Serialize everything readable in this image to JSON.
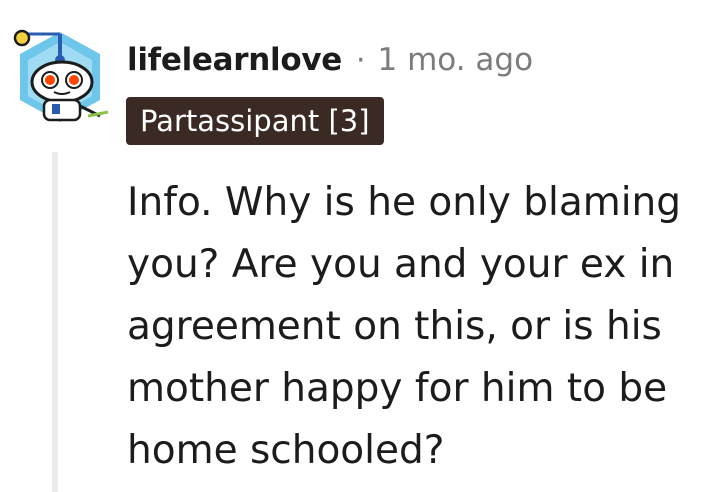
{
  "comment": {
    "author": "lifelearnlove",
    "separator": "·",
    "timestamp": "1 mo. ago",
    "flair": "Partassipant [3]",
    "body": "Info. Why is he only blaming you? Are you and your ex in agreement on this, or is his mother happy for him to be home schooled?"
  },
  "avatar": {
    "icon": "snoo-robot-avatar-icon",
    "colors": {
      "hexagon": "#6ec6ea",
      "body": "#ffffff",
      "eyes": "#ff4500",
      "antenna": "#2a5db0",
      "accent": "#f4d03f"
    }
  }
}
